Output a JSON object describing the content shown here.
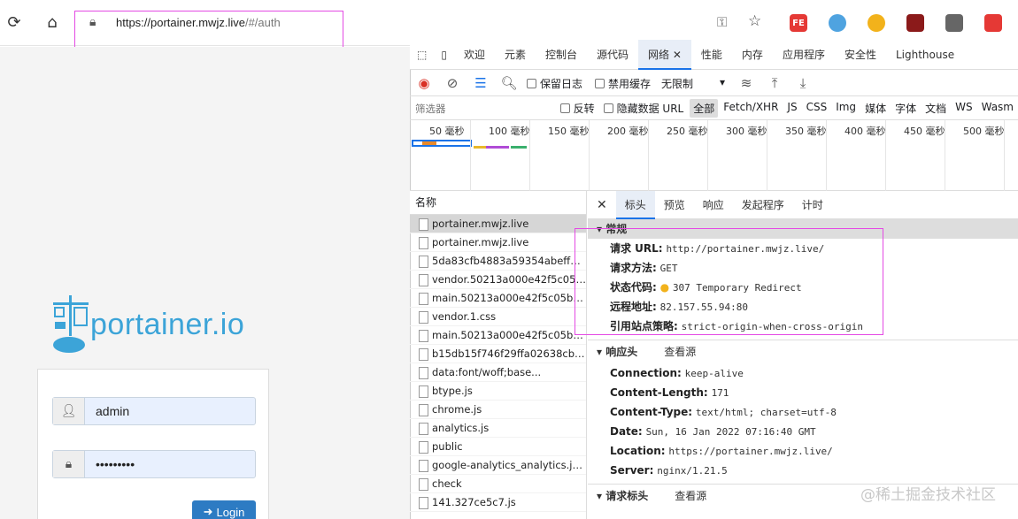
{
  "browser": {
    "url_host": "https://portainer.mwjz.live",
    "url_path": "/#/auth",
    "extensions": [
      {
        "name": "fe-extension-icon",
        "text": "FE",
        "color": "#e53935"
      },
      {
        "name": "translate-extension-icon",
        "text": "",
        "color": "#4fa3e0"
      },
      {
        "name": "colorful-extension-icon",
        "text": "",
        "color": "#f2b21b"
      },
      {
        "name": "ublock-extension-icon",
        "text": "",
        "color": "#8b1a1a"
      },
      {
        "name": "collections-icon",
        "text": "",
        "color": "#666666"
      },
      {
        "name": "refresh-extension-icon",
        "text": "",
        "color": "#e53935"
      }
    ]
  },
  "login": {
    "logo_text": "portainer.io",
    "username": "admin",
    "password": "•••••••••",
    "button_label": "Login"
  },
  "devtools": {
    "tabs": [
      "欢迎",
      "元素",
      "控制台",
      "源代码",
      "网络",
      "性能",
      "内存",
      "应用程序",
      "安全性",
      "Lighthouse"
    ],
    "active_tab": "网络",
    "toolbar": {
      "preserve_log": "保留日志",
      "disable_cache": "禁用缓存",
      "throttle": "无限制"
    },
    "filter": {
      "placeholder": "筛选器",
      "invert": "反转",
      "hide_data_url": "隐藏数据 URL",
      "types": [
        "全部",
        "Fetch/XHR",
        "JS",
        "CSS",
        "Img",
        "媒体",
        "字体",
        "文档",
        "WS",
        "Wasm"
      ]
    },
    "timeline_ticks": [
      "50 毫秒",
      "100 毫秒",
      "150 毫秒",
      "200 毫秒",
      "250 毫秒",
      "300 毫秒",
      "350 毫秒",
      "400 毫秒",
      "450 毫秒",
      "500 毫秒"
    ],
    "list_header": "名称",
    "requests": [
      "portainer.mwjz.live",
      "portainer.mwjz.live",
      "5da83cfb4883a59354abeff852...",
      "vendor.50213a000e42f5c05bc...",
      "main.50213a000e42f5c05bcc.js",
      "vendor.1.css",
      "main.50213a000e42f5c05bcc.c...",
      "b15db15f746f29ffa02638cb45...",
      "data:font/woff;base...",
      "btype.js",
      "chrome.js",
      "analytics.js",
      "public",
      "google-analytics_analytics.js?s...",
      "check",
      "141.327ce5c7.js"
    ],
    "detail_tabs": [
      "标头",
      "预览",
      "响应",
      "发起程序",
      "计时"
    ],
    "general": {
      "title": "常规",
      "rows": [
        {
          "k": "请求 URL:",
          "v": "http://portainer.mwjz.live/"
        },
        {
          "k": "请求方法:",
          "v": "GET"
        },
        {
          "k": "状态代码:",
          "v": "307 Temporary Redirect"
        },
        {
          "k": "远程地址:",
          "v": "82.157.55.94:80"
        },
        {
          "k": "引用站点策略:",
          "v": "strict-origin-when-cross-origin"
        }
      ]
    },
    "response_headers": {
      "title": "响应头",
      "view_source": "查看源",
      "rows": [
        {
          "k": "Connection:",
          "v": "keep-alive"
        },
        {
          "k": "Content-Length:",
          "v": "171"
        },
        {
          "k": "Content-Type:",
          "v": "text/html; charset=utf-8"
        },
        {
          "k": "Date:",
          "v": "Sun, 16 Jan 2022 07:16:40 GMT"
        },
        {
          "k": "Location:",
          "v": "https://portainer.mwjz.live/"
        },
        {
          "k": "Server:",
          "v": "nginx/1.21.5"
        }
      ]
    },
    "request_headers": {
      "title": "请求标头",
      "view_source": "查看源"
    }
  },
  "watermark": "@稀土掘金技术社区"
}
